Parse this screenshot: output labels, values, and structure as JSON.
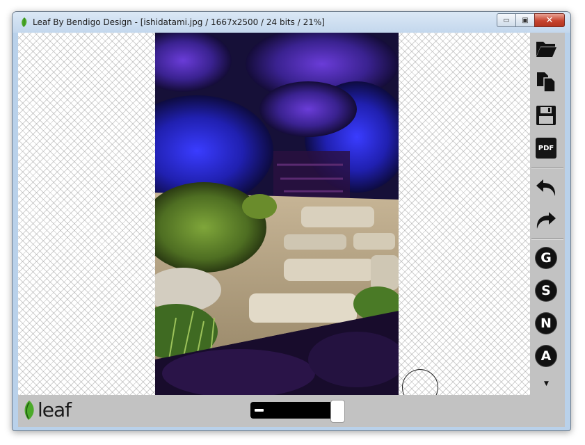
{
  "window": {
    "title": "Leaf By Bendigo Design - [ishidatami.jpg / 1667x2500 / 24 bits / 21%]",
    "caption_buttons": {
      "minimize": "▭",
      "maximize": "▣",
      "close": "✕"
    }
  },
  "toolbar": {
    "open": "open-folder-icon",
    "copy": "copy-icon",
    "save": "save-disk-icon",
    "pdf_label": "PDF",
    "undo": "undo-icon",
    "redo": "redo-icon",
    "g_label": "G",
    "s_label": "S",
    "n_label": "N",
    "a_label": "A",
    "more": "▼"
  },
  "statusbar": {
    "logo_text": "leaf",
    "slider_level": 1.0
  },
  "colors": {
    "accent_green": "#4caa2a",
    "panel_gray": "#c2c2c2",
    "window_frame": "#b9d1ea"
  }
}
